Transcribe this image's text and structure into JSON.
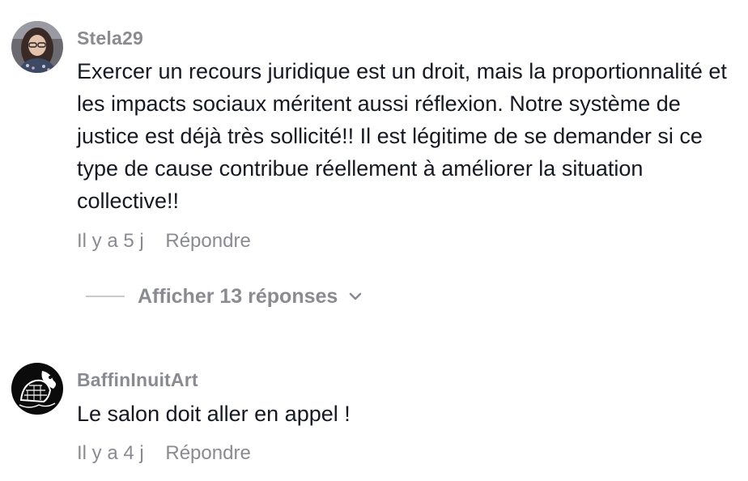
{
  "comments": [
    {
      "username": "Stela29",
      "text": "Exercer un recours juridique est un droit, mais la proportionnalité et les impacts sociaux méritent aussi réflexion. Notre système de justice est déjà très sollicité!! Il est légitime de se demander si ce type de cause contribue réellement à améliorer la situation collective!!",
      "time": "Il y a 5 j",
      "reply_label": "Répondre",
      "view_replies": "Afficher 13 réponses"
    },
    {
      "username": "BaffinInuitArt",
      "text": "Le salon doit aller en appel !",
      "time": "Il y a 4 j",
      "reply_label": "Répondre"
    }
  ],
  "icons": {
    "expand": "chevron-down-icon"
  },
  "colors": {
    "text": "#161823",
    "secondary": "#8a8b91"
  }
}
